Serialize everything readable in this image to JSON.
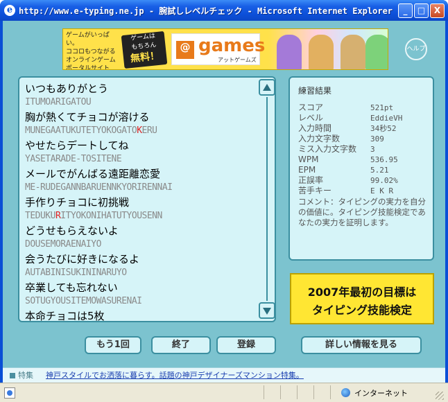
{
  "window": {
    "title": "http://www.e-typing.ne.jp - 腕試しレベルチェック - Microsoft Internet Explorer",
    "min_label": "_",
    "max_label": "□",
    "close_label": "X"
  },
  "banner": {
    "left_lines": [
      "ゲームがいっぱい。",
      "ココロもつながる",
      "オンラインゲーム",
      "ポータルサイト"
    ],
    "badge_top": "ゲームは",
    "badge_mid": "もちろん",
    "badge_free": "無料！",
    "logo_at": "@",
    "logo_text": "games",
    "logo_sub": "アットゲームズ"
  },
  "help": {
    "label": "ヘルプ"
  },
  "typing_lines": [
    {
      "jp": "いつもありがとう",
      "ro": "ITUMOARIGATOU"
    },
    {
      "jp": "胸が熱くてチョコが溶ける",
      "ro": "MUNEGAATUKUTETYOKOGATOKERU",
      "miss_index": 22
    },
    {
      "jp": "やせたらデートしてね",
      "ro": "YASETARADE-TOSITENE"
    },
    {
      "jp": "メールでがんばる遠距離恋愛",
      "ro": "ME-RUDEGANNBARUENNKYORIRENNAI"
    },
    {
      "jp": "手作りチョコに初挑戦",
      "ro": "TEDUKURITYOKONIHATUTYOUSENN",
      "miss_index": 6
    },
    {
      "jp": "どうせもらえないよ",
      "ro": "DOUSEMORAENAIYO"
    },
    {
      "jp": "会うたびに好きになるよ",
      "ro": "AUTABINISUKININARUYO"
    },
    {
      "jp": "卒業しても忘れない",
      "ro": "SOTUGYOUSITEMOWASURENAI"
    },
    {
      "jp": "本命チョコは5枚",
      "ro": ""
    }
  ],
  "results": {
    "title": "練習結果",
    "rows": [
      {
        "key": "スコア",
        "value": "521pt"
      },
      {
        "key": "レベル",
        "value": "EddieVH"
      },
      {
        "key": "入力時間",
        "value": "34秒52"
      },
      {
        "key": "入力文字数",
        "value": "309"
      },
      {
        "key": "ミス入力文字数",
        "value": "3"
      },
      {
        "key": "WPM",
        "value": "536.95"
      },
      {
        "key": "EPM",
        "value": "5.21"
      },
      {
        "key": "正誤率",
        "value": "99.02%"
      },
      {
        "key": "苦手キー",
        "value": "E K R"
      }
    ],
    "comment": "コメント：タイピングの実力を自分の価値に。タイピング技能検定であなたの実力を証明します。"
  },
  "promo": {
    "line1": "2007年最初の目標は",
    "line2": "タイピング技能検定"
  },
  "buttons": {
    "again": "もう1回",
    "end": "終了",
    "register": "登録",
    "details": "詳しい情報を見る"
  },
  "feature": {
    "label": "特集",
    "link": "神戸スタイルでお洒落に暮らす。話題の神戸デザイナーズマンション特集。"
  },
  "status": {
    "zone": "インターネット"
  },
  "colors": {
    "panel_bg": "#d6f4f8",
    "panel_border": "#3b8fa0",
    "page_bg": "#7cc3cf",
    "miss_char": "#e02020",
    "promo_bg": "#ffe633"
  }
}
